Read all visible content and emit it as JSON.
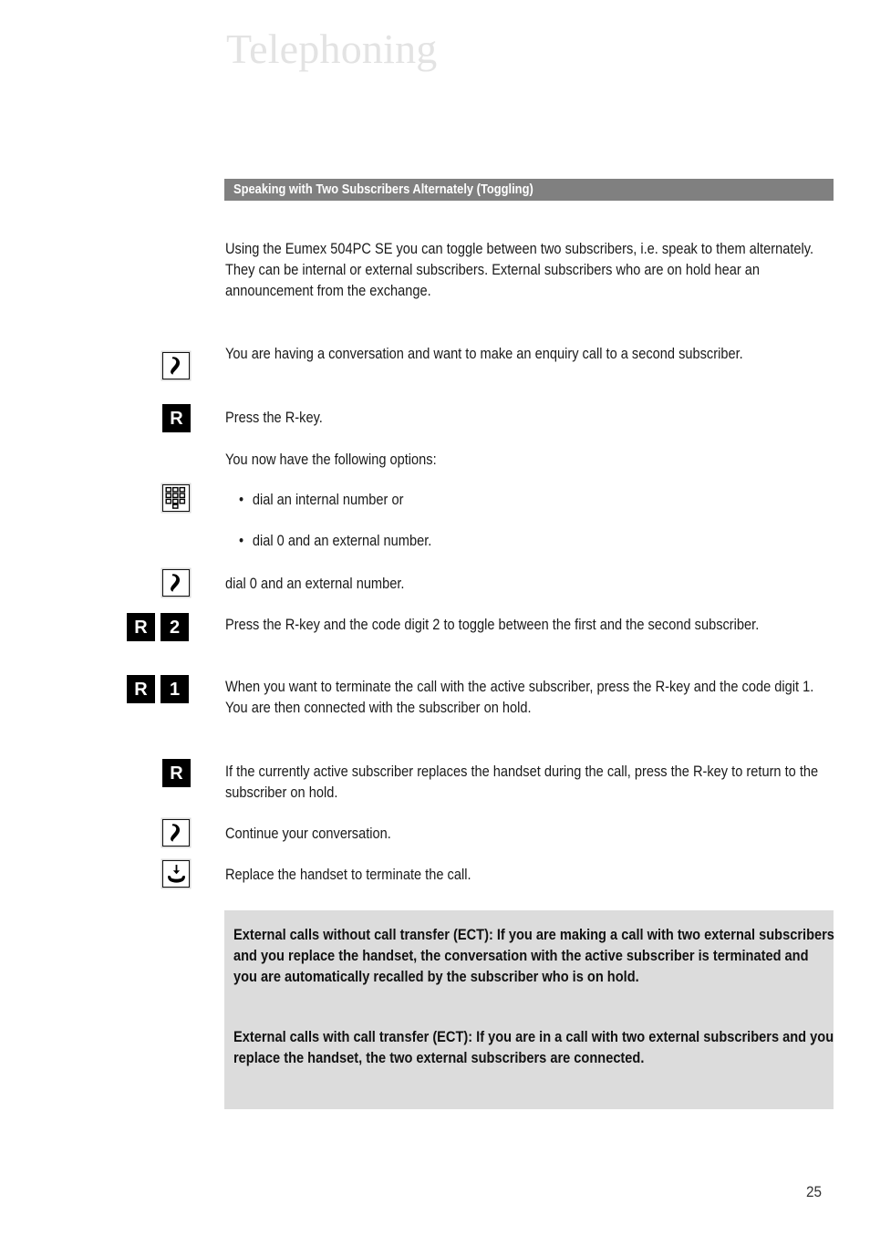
{
  "page": {
    "chapter_title": "Telephoning",
    "page_number": "25"
  },
  "section": {
    "heading": "Speaking with Two Subscribers Alternately (Toggling)"
  },
  "intro": {
    "paragraph": "Using the Eumex 504PC SE you can toggle between two subscribers, i.e. speak to them alternately. They can be internal or external subscribers. External subscribers who are on hold hear an announcement from the exchange."
  },
  "steps": [
    {
      "icons": [
        "handset-icon"
      ],
      "text": "You are having a conversation and want to make an enquiry call to a second subscriber."
    },
    {
      "icons": [
        "r-key"
      ],
      "key_labels": [
        "R"
      ],
      "text": "Press the R-key."
    },
    {
      "icons": [],
      "text": "You now have the following options:"
    },
    {
      "icons": [
        "keypad-icon"
      ],
      "bullets": [
        "dial an internal number or",
        "dial 0 and an external number."
      ],
      "bullet_char": "•"
    },
    {
      "icons": [
        "handset-icon"
      ],
      "text": "dial 0 and an external number."
    },
    {
      "icons": [
        "r-key",
        "digit-key"
      ],
      "key_labels": [
        "R",
        "2"
      ],
      "text": "Press the R-key and the code digit 2 to toggle between the first and the second subscriber."
    },
    {
      "icons": [
        "r-key",
        "digit-key"
      ],
      "key_labels": [
        "R",
        "1"
      ],
      "text": "When you want to terminate the call with the active subscriber, press the R-key and the code digit 1. You are then connected with the subscriber on hold."
    },
    {
      "icons": [
        "r-key"
      ],
      "key_labels": [
        "R"
      ],
      "text": "If the currently active subscriber replaces the handset during the call, press the R-key to return to the subscriber on hold."
    },
    {
      "icons": [
        "handset-icon"
      ],
      "text": "Continue your conversation."
    },
    {
      "icons": [
        "hangup-icon"
      ],
      "text": "Replace the handset to terminate the call."
    }
  ],
  "note_box": {
    "paragraphs": [
      "External calls without call transfer (ECT): If you are making a call with two external subscribers and you replace the handset, the conversation with the active subscriber is terminated and you are automatically recalled by the subscriber who is on hold.",
      "External calls with call transfer (ECT): If you are in a call with two external subscribers and you replace the handset, the two external subscribers are connected."
    ],
    "background_color": "#dcdcdc"
  },
  "colors": {
    "section_bar": "#808080",
    "title_gray": "#e3e3e3",
    "key_black": "#000000",
    "text": "#1a1a1a"
  }
}
